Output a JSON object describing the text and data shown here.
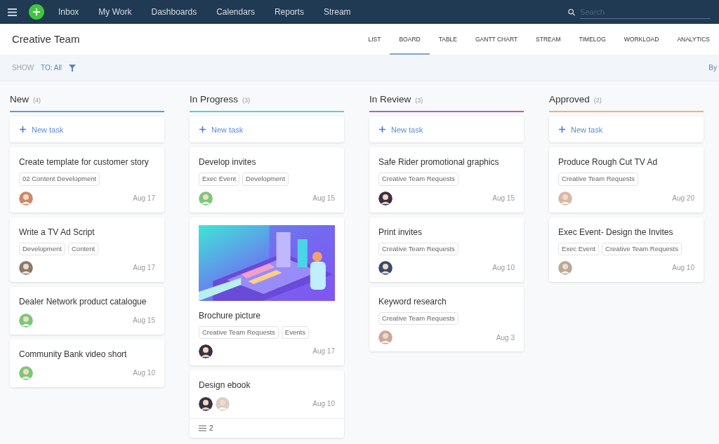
{
  "nav": {
    "items": [
      "Inbox",
      "My Work",
      "Dashboards",
      "Calendars",
      "Reports",
      "Stream"
    ],
    "search": {
      "placeholder": "Search"
    }
  },
  "header": {
    "title": "Creative Team",
    "views": [
      {
        "label": "LIST",
        "selected": false
      },
      {
        "label": "BOARD",
        "selected": true
      },
      {
        "label": "TABLE",
        "selected": false
      },
      {
        "label": "GANTT CHART",
        "selected": false
      },
      {
        "label": "STREAM",
        "selected": false
      },
      {
        "label": "TIMELOG",
        "selected": false
      },
      {
        "label": "WORKLOAD",
        "selected": false
      },
      {
        "label": "ANALYTICS",
        "selected": false
      }
    ]
  },
  "filter_bar": {
    "show_label": "SHOW",
    "filter": "TO: All",
    "right_text": "By"
  },
  "columns": [
    {
      "title": "New",
      "count": "(4)",
      "color": "#5b9be0",
      "new_task": "New task",
      "cards": [
        {
          "title": "Create template for customer story",
          "tags": [
            "02 Content Development"
          ],
          "assignees": [
            {
              "color": "#c98a6a"
            }
          ],
          "date": "Aug 17"
        },
        {
          "title": "Write a TV Ad Script",
          "tags": [
            "Development",
            "Content"
          ],
          "assignees": [
            {
              "color": "#8a7a6a"
            }
          ],
          "date": "Aug 17"
        },
        {
          "title": "Dealer Network product catalogue",
          "assignees": [
            {
              "color": "#7cc77a"
            }
          ],
          "date": "Aug 15"
        },
        {
          "title": "Community Bank video short",
          "assignees": [
            {
              "color": "#7cc77a"
            }
          ],
          "date": "Aug 10"
        }
      ]
    },
    {
      "title": "In Progress",
      "count": "(3)",
      "color": "#5ccfcf",
      "new_task": "New task",
      "cards": [
        {
          "title": "Develop invites",
          "tags": [
            "Exec Event",
            "Development"
          ],
          "assignees": [
            {
              "color": "#7cc77a"
            }
          ],
          "date": "Aug 15"
        },
        {
          "kind": "picture",
          "title": "Brochure picture",
          "tags": [
            "Creative Team Requests",
            "Events"
          ],
          "assignees": [
            {
              "color": "#3a3040"
            }
          ],
          "date": "Aug 17"
        },
        {
          "title": "Design ebook",
          "assignees": [
            {
              "color": "#3a3040"
            },
            {
              "color": "#d8cfc8"
            }
          ],
          "date": "Aug 10",
          "subtasks": "2"
        }
      ]
    },
    {
      "title": "In Review",
      "count": "(3)",
      "color": "#b25fc9",
      "new_task": "New task",
      "cards": [
        {
          "title": "Safe Rider promotional graphics",
          "tags": [
            "Creative Team Requests"
          ],
          "assignees": [
            {
              "color": "#3a3040"
            }
          ],
          "date": "Aug 15"
        },
        {
          "title": "Print invites",
          "tags": [
            "Creative Team Requests"
          ],
          "assignees": [
            {
              "color": "#3a4a6a"
            }
          ],
          "date": "Aug 10"
        },
        {
          "title": "Keyword research",
          "tags": [
            "Creative Team Requests"
          ],
          "assignees": [
            {
              "color": "#c9a89a"
            }
          ],
          "date": "Aug 3"
        }
      ]
    },
    {
      "title": "Approved",
      "count": "(2)",
      "color": "#f2b36a",
      "new_task": "New task",
      "cards": [
        {
          "title": "Produce Rough Cut TV Ad",
          "tags": [
            "Creative Team Requests"
          ],
          "assignees": [
            {
              "color": "#d8b8a8"
            }
          ],
          "date": "Aug 20"
        },
        {
          "title": "Exec Event- Design the Invites",
          "tags": [
            "Exec Event",
            "Creative Team Requests"
          ],
          "assignees": [
            {
              "color": "#b8a898"
            }
          ],
          "date": "Aug 10"
        }
      ]
    }
  ]
}
